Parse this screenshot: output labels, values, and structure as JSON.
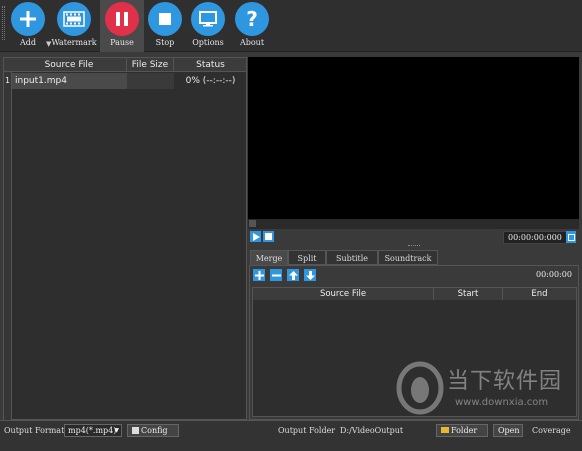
{
  "toolbar": {
    "add": "Add",
    "watermark": "Watermark",
    "pause": "Pause",
    "stop": "Stop",
    "options": "Options",
    "about": "About"
  },
  "file_table": {
    "headers": [
      "Source File",
      "File Size",
      "Status"
    ],
    "rows": [
      {
        "index": "1",
        "source": "input1.mp4",
        "size": "",
        "status": "0% (--:--:--)"
      }
    ]
  },
  "player": {
    "time": "00:00:00:000"
  },
  "tabs": [
    "Merge",
    "Split",
    "Subtitle",
    "Soundtrack"
  ],
  "merge": {
    "duration": "00:00:00",
    "headers": [
      "Source File",
      "Start",
      "End"
    ]
  },
  "bottom": {
    "output_format_label": "Output Format",
    "output_format_value": "mp4(*.mp4)",
    "config_label": "Config",
    "output_folder_label": "Output Folder",
    "output_folder_value": "D:/VideoOutput",
    "folder_button": "Folder",
    "open_button": "Open",
    "coverage_label": "Coverage"
  },
  "watermark_overlay": {
    "cn_name": "当下软件园",
    "url": "www.downxia.com"
  },
  "colors": {
    "accent": "#2f96e0",
    "pause_active": "#e0304a"
  }
}
